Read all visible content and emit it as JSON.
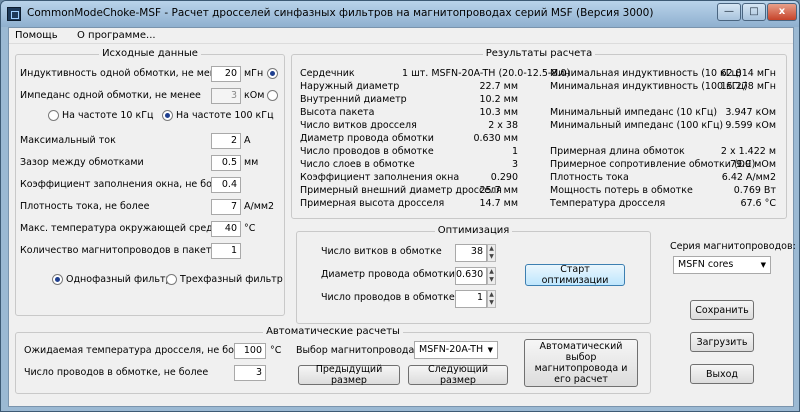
{
  "window": {
    "title": "CommonModeChoke-MSF - Расчет дросселей синфазных фильтров на магнитопроводах серий MSF (Версия 3000)",
    "minimize": "—",
    "maximize": "□",
    "close": "x"
  },
  "menu": {
    "help": "Помощь",
    "about": "О программе..."
  },
  "input": {
    "title": "Исходные данные",
    "inductance_label": "Индуктивность одной обмотки, не менее",
    "inductance_value": "20",
    "inductance_unit": "мГн",
    "impedance_label": "Импеданс одной обмотки, не менее",
    "impedance_value": "3",
    "impedance_unit": "кОм",
    "freq10": "На частоте 10 кГц",
    "freq100": "На частоте 100 кГц",
    "max_current_label": "Максимальный ток",
    "max_current_value": "2",
    "max_current_unit": "А",
    "gap_label": "Зазор между обмотками",
    "gap_value": "0.5",
    "gap_unit": "мм",
    "fill_label": "Коэффициент заполнения окна, не более",
    "fill_value": "0.4",
    "density_label": "Плотность тока, не более",
    "density_value": "7",
    "density_unit": "А/мм2",
    "ambient_label": "Макс. температура окружающей среды",
    "ambient_value": "40",
    "ambient_unit": "°C",
    "cores_label": "Количество магнитопроводов  в пакете",
    "cores_value": "1",
    "single_phase": "Однофазный фильтр",
    "three_phase": "Трехфазный фильтр"
  },
  "results": {
    "title": "Результаты расчета",
    "left": [
      {
        "label": "Сердечник",
        "value": "1 шт. MSFN-20A-TH (20.0-12.5-8.0)"
      },
      {
        "label": "Наружный диаметр",
        "value": "22.7 мм"
      },
      {
        "label": "Внутренний диаметр",
        "value": "10.2 мм"
      },
      {
        "label": "Высота пакета",
        "value": "10.3 мм"
      },
      {
        "label": "Число витков дросселя",
        "value": "2 x 38"
      },
      {
        "label": "Диаметр провода обмотки",
        "value": "0.630 мм"
      },
      {
        "label": "Число проводов в обмотке",
        "value": "1"
      },
      {
        "label": "Число слоев в обмотке",
        "value": "3"
      },
      {
        "label": "Коэффициент заполнения окна",
        "value": "0.290"
      },
      {
        "label": "Примерный внешний диаметр дросселя",
        "value": "25.7 мм"
      },
      {
        "label": "Примерная высота дросселя",
        "value": "14.7 мм"
      }
    ],
    "right": [
      {
        "label": "Минимальная индуктивность (10 кГц)",
        "value": "62.814 мГн"
      },
      {
        "label": "Минимальная индуктивность (100 кГц)",
        "value": "15.278 мГн"
      },
      {
        "label": "",
        "value": ""
      },
      {
        "label": "Минимальный импеданс (10 кГц)",
        "value": "3.947 кОм"
      },
      {
        "label": "Минимальный импеданс (100 кГц)",
        "value": "9.599 кОм"
      },
      {
        "label": "",
        "value": ""
      },
      {
        "label": "Примерная длина обмоток",
        "value": "2 x 1.422 м"
      },
      {
        "label": "Примерное сопротивление обмотки (DC)",
        "value": "79.9 мОм"
      },
      {
        "label": "Плотность тока",
        "value": "6.42 А/мм2"
      },
      {
        "label": "Мощность потерь в обмотке",
        "value": "0.769 Вт"
      },
      {
        "label": "Температура дросселя",
        "value": "67.6 °C"
      }
    ]
  },
  "optimization": {
    "title": "Оптимизация",
    "turns_label": "Число витков в обмотке",
    "turns_value": "38",
    "wire_label": "Диаметр провода обмотки, мм",
    "wire_value": "0.630",
    "wires_label": "Число проводов в обмотке",
    "wires_value": "1",
    "start": "Старт оптимизации"
  },
  "series": {
    "label": "Серия магнитопроводов:",
    "value": "MSFN cores"
  },
  "auto": {
    "title": "Автоматические расчеты",
    "temp_label": "Ожидаемая температура дросселя, не более",
    "temp_value": "100",
    "temp_unit": "°C",
    "wires_label": "Число проводов в обмотке, не более",
    "wires_value": "3",
    "core_label": "Выбор магнитопровода:",
    "core_value": "MSFN-20A-TH",
    "prev": "Предыдущий размер",
    "next": "Следующий размер",
    "auto_select": "Автоматический выбор магнитопровода и его расчет"
  },
  "buttons": {
    "save": "Сохранить",
    "load": "Загрузить",
    "exit": "Выход"
  }
}
